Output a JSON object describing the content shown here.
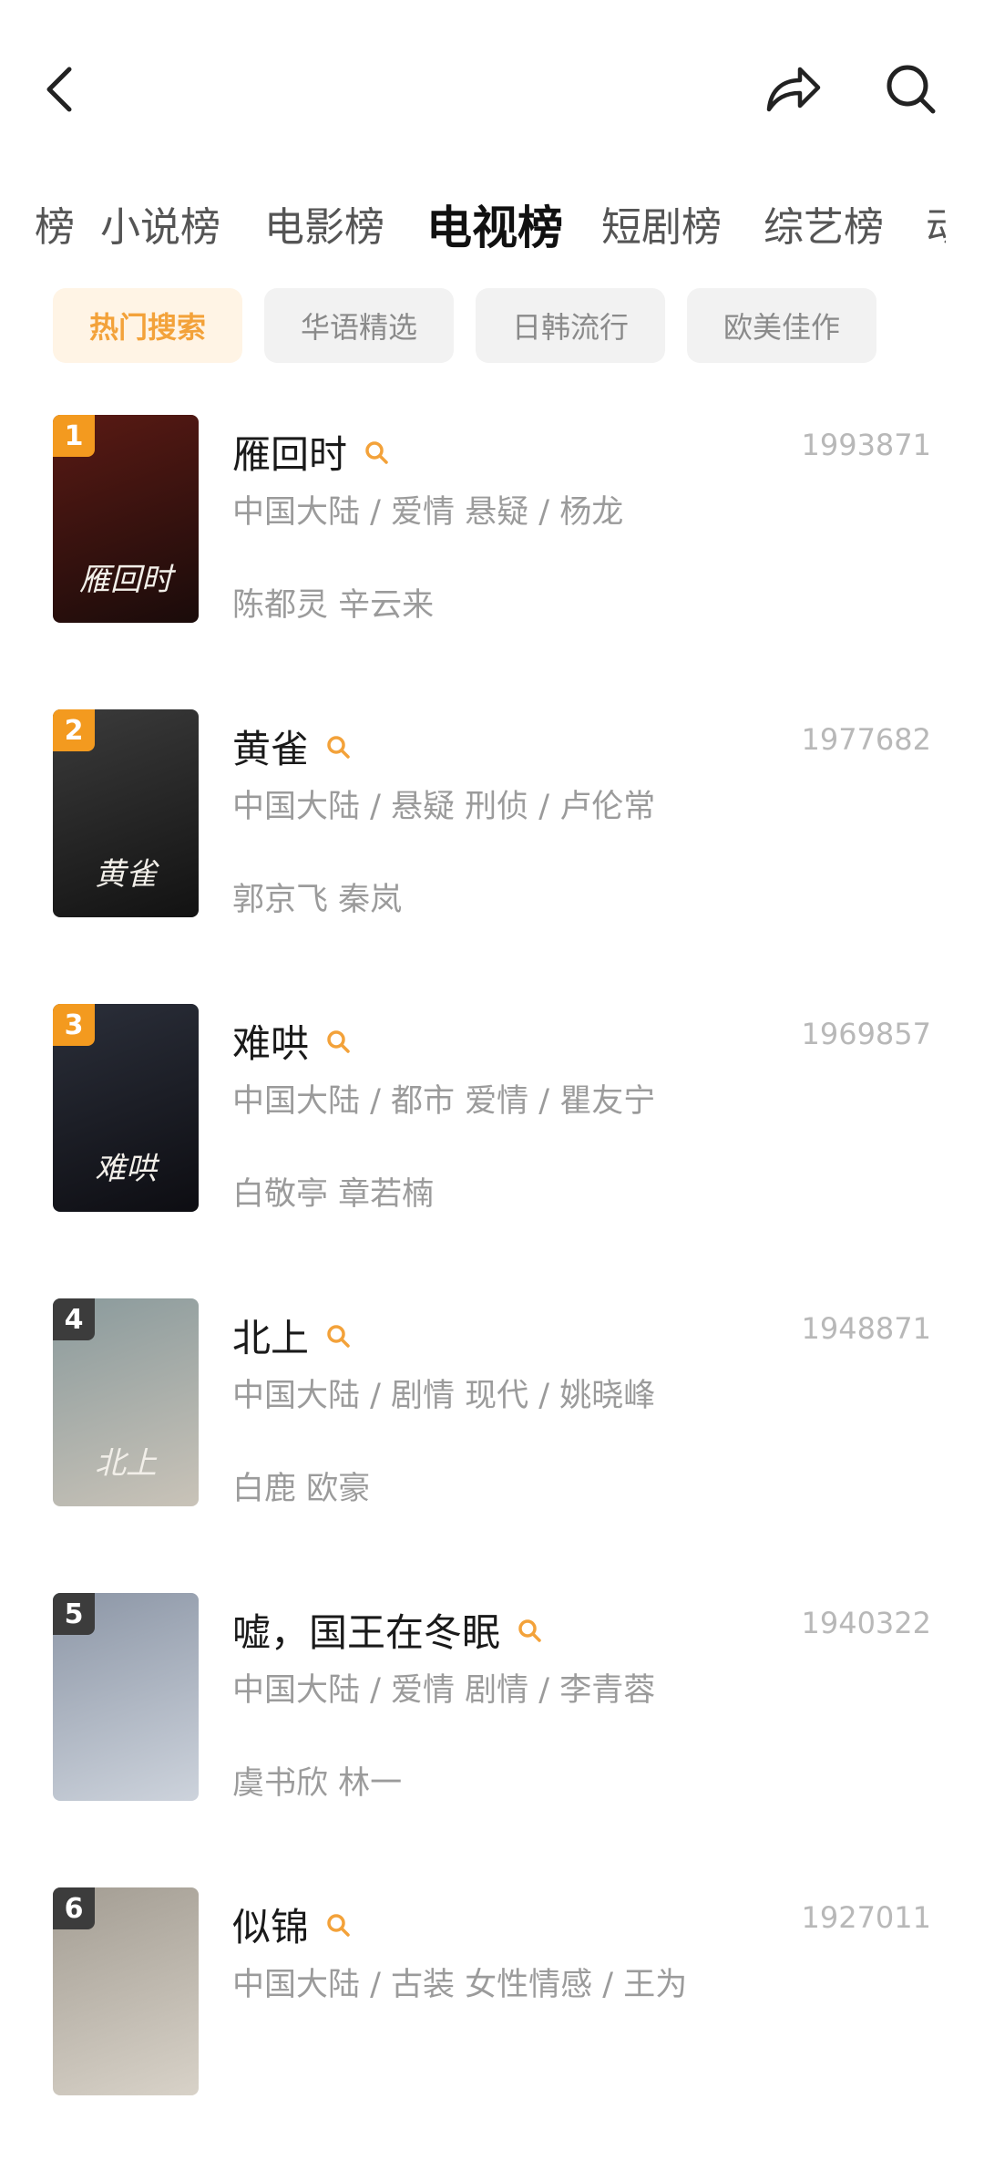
{
  "header": {
    "back_icon": "chevron-left-icon",
    "share_icon": "share-arrow-icon",
    "search_icon": "search-icon"
  },
  "tabs": [
    {
      "label": "榜"
    },
    {
      "label": "小说榜"
    },
    {
      "label": "电影榜"
    },
    {
      "label": "电视榜",
      "active": true
    },
    {
      "label": "短剧榜"
    },
    {
      "label": "综艺榜"
    },
    {
      "label": "动"
    }
  ],
  "chips": [
    {
      "label": "热门搜索",
      "active": true
    },
    {
      "label": "华语精选"
    },
    {
      "label": "日韩流行"
    },
    {
      "label": "欧美佳作"
    }
  ],
  "accent_color": "#f3a23a",
  "items": [
    {
      "rank": "1",
      "rank_color": "#f39a1f",
      "title": "雁回时",
      "score": "1993871",
      "meta": "中国大陆 / 爱情 悬疑 / 杨龙",
      "actors": "陈都灵 辛云来",
      "poster_text": "雁回时",
      "poster_colors": [
        "#5a1a14",
        "#1a0b0a"
      ]
    },
    {
      "rank": "2",
      "rank_color": "#f39a1f",
      "title": "黄雀",
      "score": "1977682",
      "meta": "中国大陆 / 悬疑 刑侦 / 卢伦常",
      "actors": "郭京飞 秦岚",
      "poster_text": "黄雀",
      "poster_colors": [
        "#3b3b3b",
        "#121212"
      ]
    },
    {
      "rank": "3",
      "rank_color": "#f39a1f",
      "title": "难哄",
      "score": "1969857",
      "meta": "中国大陆 / 都市 爱情 / 瞿友宁",
      "actors": "白敬亭 章若楠",
      "poster_text": "难哄",
      "poster_colors": [
        "#2b2f3a",
        "#0d0d12"
      ]
    },
    {
      "rank": "4",
      "rank_color": "#3c3c3c",
      "title": "北上",
      "score": "1948871",
      "meta": "中国大陆 / 剧情 现代 / 姚晓峰",
      "actors": "白鹿 欧豪",
      "poster_text": "北上",
      "poster_colors": [
        "#8a9a9c",
        "#c9c3b8"
      ]
    },
    {
      "rank": "5",
      "rank_color": "#3c3c3c",
      "title": "嘘，国王在冬眠",
      "score": "1940322",
      "meta": "中国大陆 / 爱情 剧情 / 李青蓉",
      "actors": "虞书欣 林一",
      "poster_text": "",
      "poster_colors": [
        "#8c96a6",
        "#cdd3dc"
      ]
    },
    {
      "rank": "6",
      "rank_color": "#3c3c3c",
      "title": "似锦",
      "score": "1927011",
      "meta": "中国大陆 / 古装 女性情感 / 王为",
      "actors": "",
      "poster_text": "",
      "poster_colors": [
        "#a39d93",
        "#d8d2c8"
      ]
    }
  ]
}
